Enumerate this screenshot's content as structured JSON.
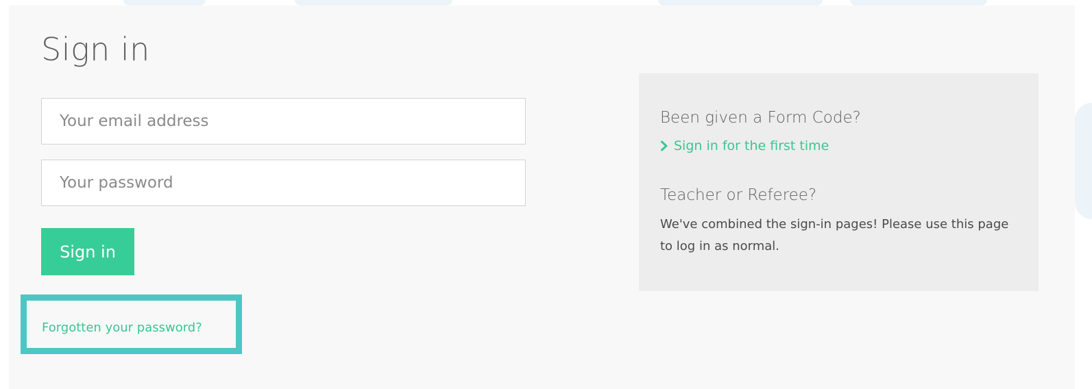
{
  "login": {
    "title": "Sign in",
    "email_placeholder": "Your email address",
    "password_placeholder": "Your password",
    "submit_label": "Sign in",
    "forgot_label": "Forgotten your password?"
  },
  "sidebar": {
    "form_code_heading": "Been given a Form Code?",
    "first_time_label": "Sign in for the first time",
    "teacher_heading": "Teacher or Referee?",
    "teacher_text": "We've combined the sign-in pages! Please use this page to log in as normal."
  },
  "icons": {
    "first_time_link": "chevron-right-icon"
  },
  "colors": {
    "accent": "#37cd98",
    "link": "#37c792",
    "highlight": "#4cc7c4",
    "panel_background": "#f8f8f8",
    "side_box_background": "#ededed"
  }
}
